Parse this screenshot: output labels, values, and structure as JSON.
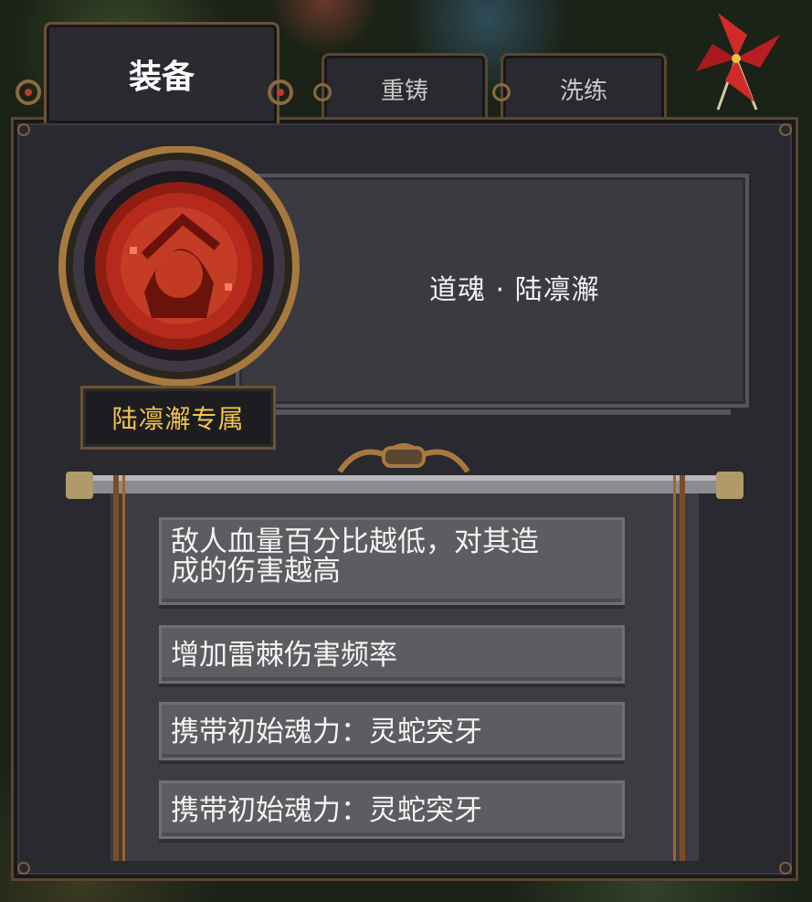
{
  "tabs": [
    {
      "label": "装备",
      "active": true
    },
    {
      "label": "重铸",
      "active": false
    },
    {
      "label": "洗练",
      "active": false
    }
  ],
  "item": {
    "name": "道魂 · 陆凛澥",
    "exclusive_label": "陆凛澥专属",
    "portrait_icon": "soul-portrait-medal"
  },
  "effects": [
    {
      "text1": "敌人血量百分比越低，对其造",
      "text2": "成的伤害越高"
    },
    {
      "text1": "增加雷棘伤害频率"
    },
    {
      "text1": "携带初始魂力：灵蛇突牙"
    },
    {
      "text1": "携带初始魂力：灵蛇突牙"
    }
  ],
  "icons": {
    "close": "pinwheel-close-icon"
  },
  "colors": {
    "accent_gold": "#f3c64a",
    "frame_bronze": "#6b5335",
    "medal_red": "#b52a1c"
  }
}
